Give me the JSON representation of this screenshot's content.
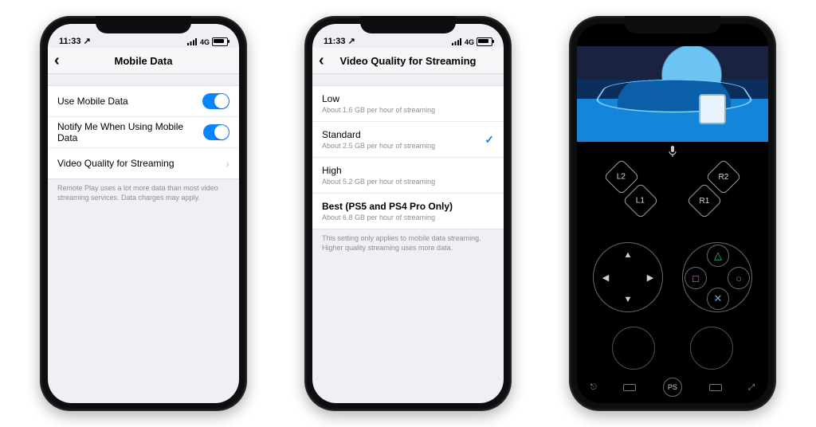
{
  "status_bar": {
    "time": "11:33",
    "arrow": "↗",
    "network": "4G"
  },
  "phone1": {
    "title": "Mobile Data",
    "rows": {
      "use_mobile": "Use Mobile Data",
      "notify": "Notify Me When Using Mobile Data",
      "quality": "Video Quality for Streaming"
    },
    "footnote": "Remote Play uses a lot more data than most video streaming services. Data charges may apply."
  },
  "phone2": {
    "title": "Video Quality for Streaming",
    "options": [
      {
        "title": "Low",
        "sub": "About 1.6 GB per hour of streaming",
        "selected": false
      },
      {
        "title": "Standard",
        "sub": "About 2.5 GB per hour of streaming",
        "selected": true
      },
      {
        "title": "High",
        "sub": "About 5.2 GB per hour of streaming",
        "selected": false
      },
      {
        "title": "Best (PS5 and PS4 Pro Only)",
        "sub": "About 6.8 GB per hour of streaming",
        "selected": false
      }
    ],
    "footnote": "This setting only applies to mobile data streaming. Higher quality streaming uses more data."
  },
  "phone3": {
    "shoulder": {
      "l2": "L2",
      "l1": "L1",
      "r2": "R2",
      "r1": "R1"
    },
    "face": {
      "triangle": "△",
      "circle": "○",
      "cross": "✕",
      "square": "□"
    },
    "dpad": {
      "up": "▲",
      "down": "▼",
      "left": "◀",
      "right": "▶"
    },
    "ps_label": "PS",
    "mic_icon": "mic-icon"
  }
}
